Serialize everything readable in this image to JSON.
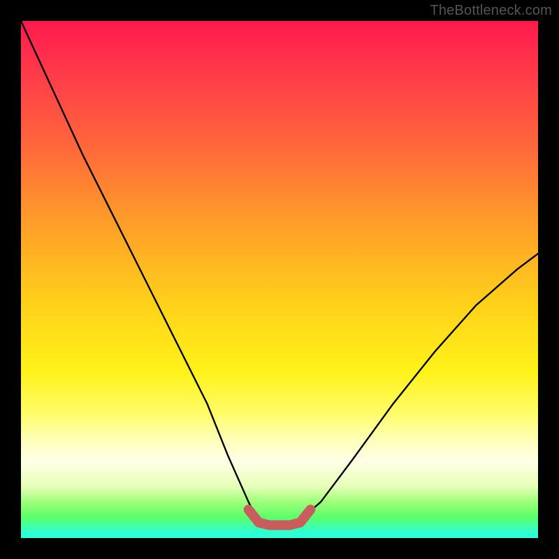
{
  "branding": {
    "watermark": "TheBottleneck.com"
  },
  "chart_data": {
    "type": "line",
    "title": "",
    "xlabel": "",
    "ylabel": "",
    "xlim": [
      0,
      100
    ],
    "ylim": [
      0,
      100
    ],
    "grid": false,
    "legend": false,
    "series": [
      {
        "name": "bottleneck-curve",
        "x": [
          0,
          6,
          12,
          18,
          24,
          30,
          36,
          40,
          44,
          46,
          48,
          50,
          52,
          54,
          58,
          64,
          72,
          80,
          88,
          96,
          100
        ],
        "y": [
          100,
          87,
          74,
          62,
          50,
          38,
          26,
          16,
          7,
          3,
          2.5,
          2.5,
          2.5,
          3.5,
          7,
          15,
          26,
          36,
          45,
          52,
          55
        ],
        "color": "#000000"
      },
      {
        "name": "bottom-highlight",
        "x": [
          44,
          46,
          48,
          50,
          52,
          54,
          56
        ],
        "y": [
          5.5,
          3,
          2.5,
          2.5,
          2.5,
          3,
          5.5
        ],
        "color": "#c95c5c"
      }
    ],
    "notes": "Axes have no visible labels/ticks. Background is a vertical rainbow gradient from red (top) through yellow to green/cyan (bottom). A thin black line descends steeply from top-left, bottoms out near x≈50 where a short thicker salmon segment marks the minimum, then rises less steeply toward the right edge reaching roughly half height."
  }
}
